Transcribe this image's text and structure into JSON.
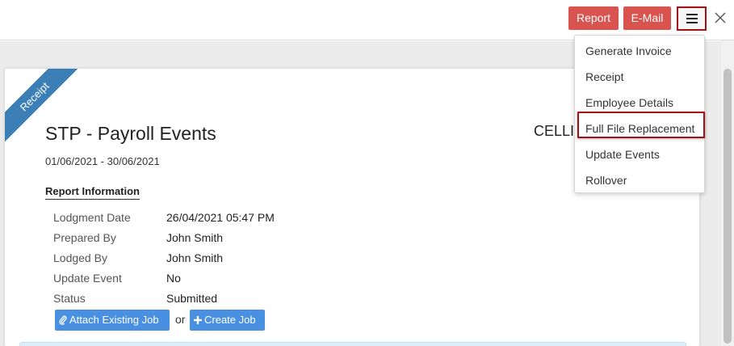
{
  "header": {
    "report_label": "Report",
    "email_label": "E-Mail",
    "menu_icon": "hamburger-icon",
    "close_icon": "close-icon",
    "accent_red": "#d9534f"
  },
  "menu": {
    "items": [
      {
        "label": "Generate Invoice"
      },
      {
        "label": "Receipt"
      },
      {
        "label": "Employee Details"
      },
      {
        "label": "Full File Replacement",
        "highlighted": true
      },
      {
        "label": "Update Events"
      },
      {
        "label": "Rollover"
      }
    ]
  },
  "report": {
    "ribbon": "Receipt",
    "title": "STP - Payroll Events",
    "company": "CELLI",
    "period": "01/06/2021 - 30/06/2021",
    "section_title": "Report Information",
    "info": [
      {
        "label": "Lodgment Date",
        "value": "26/04/2021 05:47 PM"
      },
      {
        "label": "Prepared By",
        "value": "John Smith"
      },
      {
        "label": "Lodged By",
        "value": "John Smith"
      },
      {
        "label": "Update Event",
        "value": "No"
      },
      {
        "label": "Status",
        "value": "Submitted"
      }
    ],
    "attach_job_label": "Attach Existing Job",
    "or_label": "or",
    "create_job_label": "Create Job",
    "accent_blue": "#4a90e2"
  }
}
